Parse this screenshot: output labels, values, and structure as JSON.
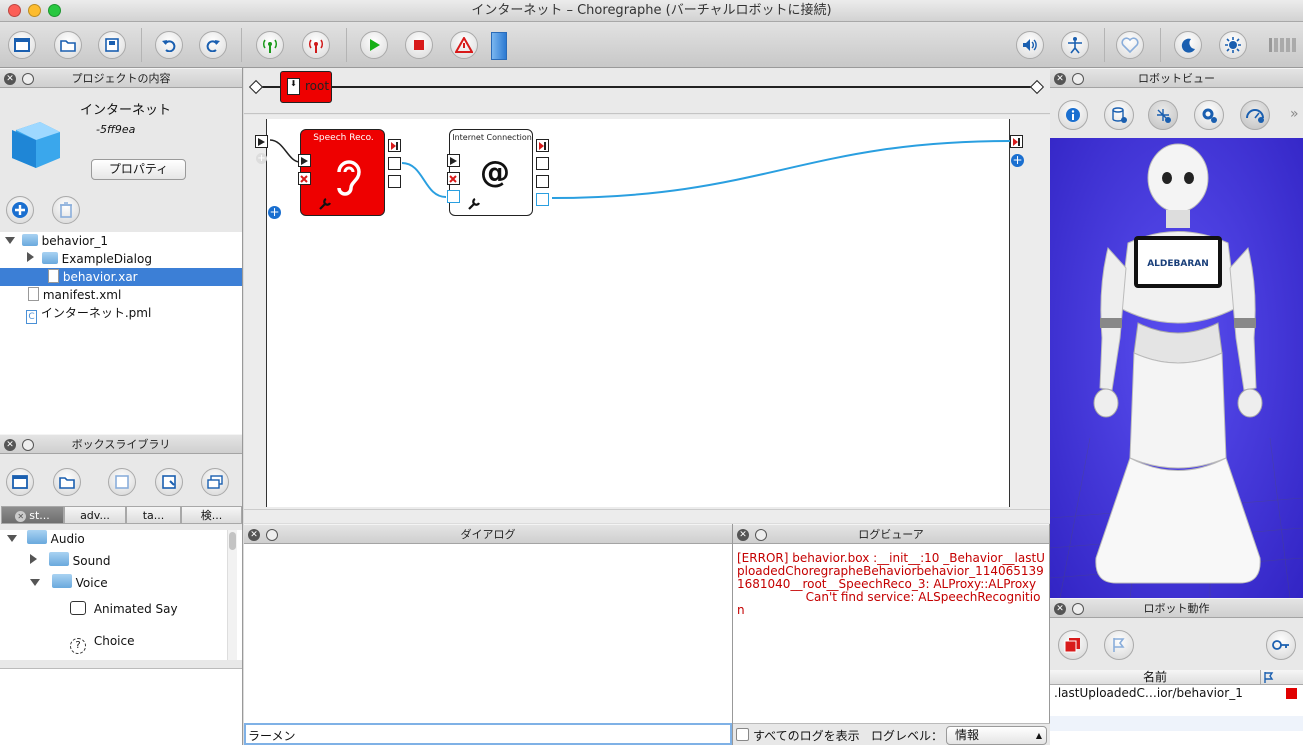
{
  "window": {
    "title": "インターネット – Choregraphe (バーチャルロボットに接続)"
  },
  "project_panel": {
    "title": "プロジェクトの内容",
    "project_name": "インターネット",
    "project_id": "-5ff9ea",
    "properties_button": "プロパティ",
    "tree": [
      {
        "label": "behavior_1"
      },
      {
        "label": "ExampleDialog"
      },
      {
        "label": "behavior.xar"
      },
      {
        "label": "manifest.xml"
      },
      {
        "label": "インターネット.pml"
      }
    ]
  },
  "box_library": {
    "title": "ボックスライブラリ",
    "tabs": [
      "st...",
      "adv...",
      "ta...",
      "検..."
    ],
    "tree": [
      {
        "label": "Audio"
      },
      {
        "label": "Sound"
      },
      {
        "label": "Voice"
      },
      {
        "label": "Animated Say"
      },
      {
        "label": "Choice"
      }
    ]
  },
  "flow": {
    "breadcrumb": "root",
    "boxes": [
      {
        "title": "Speech Reco.",
        "icon": "ear-icon"
      },
      {
        "title": "Internet Connection",
        "icon": "at-icon"
      }
    ]
  },
  "dialog_panel": {
    "title": "ダイアログ",
    "input_value": "ラーメン"
  },
  "log_panel": {
    "title": "ログビューア",
    "log_text": "[ERROR] behavior.box :__init__:10 _Behavior__lastUploadedChoregrapheBehaviorbehavior_1140651391681040__root__SpeechReco_3: ALProxy::ALProxy\n                  Can't find service: ALSpeechRecognition",
    "show_all_label": "すべてのログを表示",
    "level_label": "ログレベル：",
    "level_value": "情報"
  },
  "robot_view": {
    "title": "ロボットビュー",
    "chest_label": "ALDEBARAN"
  },
  "robot_motion": {
    "title": "ロボット動作",
    "column_name": "名前",
    "rows": [
      {
        "name": ".lastUploadedC…ior/behavior_1"
      }
    ]
  },
  "colors": {
    "accent": "#1478d2",
    "error": "#c40000",
    "box_red": "#ee0000",
    "selection": "#3c7fd6",
    "robot_bg": "#3b2fd0"
  }
}
